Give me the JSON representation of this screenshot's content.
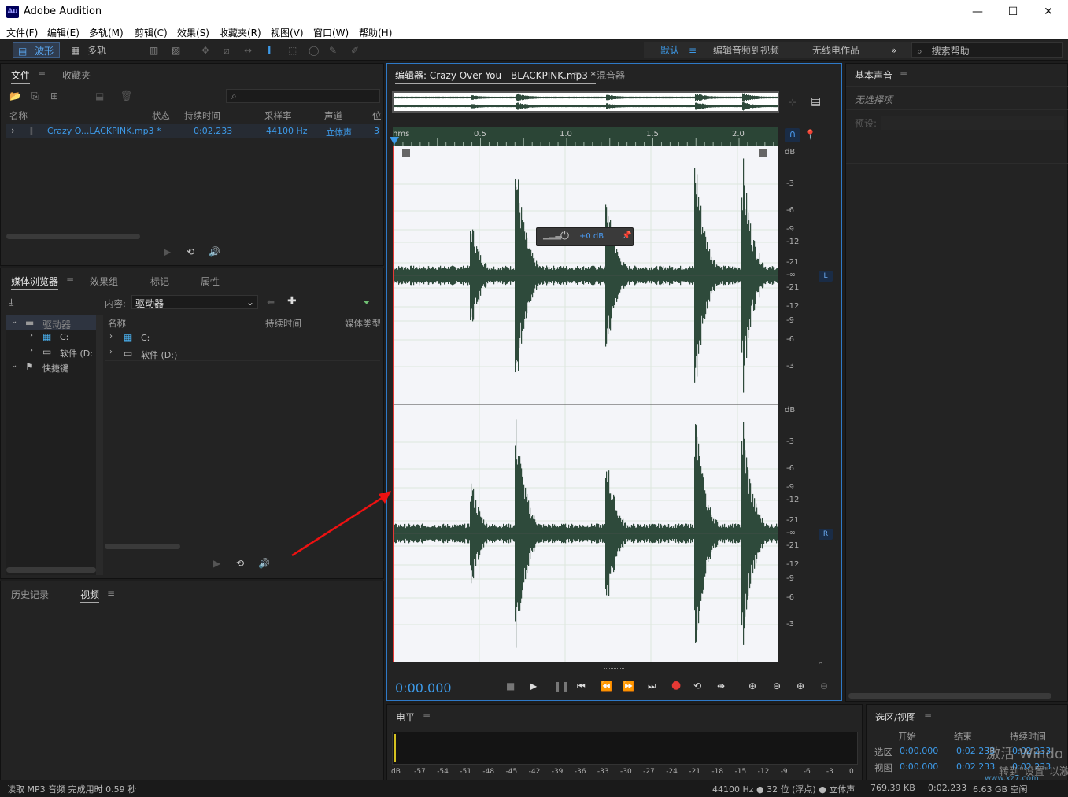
{
  "titlebar": {
    "app_title": "Adobe Audition",
    "logo": "Au",
    "minimize": "—",
    "maximize": "☐",
    "close": "✕"
  },
  "menu": [
    "文件(F)",
    "编辑(E)",
    "多轨(M)",
    "剪辑(C)",
    "效果(S)",
    "收藏夹(R)",
    "视图(V)",
    "窗口(W)",
    "帮助(H)"
  ],
  "toolbar": {
    "waveform_label": "波形",
    "multitrack_label": "多轨",
    "workspace_default": "默认",
    "workspace_edit_video": "编辑音频到视频",
    "workspace_radio": "无线电作品",
    "search_placeholder": "搜索帮助"
  },
  "files_panel": {
    "tabs": [
      "文件",
      "收藏夹"
    ],
    "columns": [
      "名称",
      "状态",
      "持续时间",
      "采样率",
      "声道",
      "位"
    ],
    "rows": [
      {
        "name": "Crazy O...LACKPINK.mp3 *",
        "duration": "0:02.233",
        "sample_rate": "44100 Hz",
        "channels": "立体声",
        "bit": "3"
      }
    ]
  },
  "media_panel": {
    "tabs": [
      "媒体浏览器",
      "效果组",
      "标记",
      "属性"
    ],
    "content_label": "内容:",
    "content_value": "驱动器",
    "tree": [
      "驱动器",
      "C:",
      "软件 (D:",
      "快捷键"
    ],
    "columns": [
      "名称",
      "持续时间",
      "媒体类型"
    ],
    "rows": [
      "C:",
      "软件 (D:)"
    ]
  },
  "history_panel": {
    "tabs": [
      "历史记录",
      "视频"
    ]
  },
  "editor": {
    "tab_label": "编辑器: Crazy Over You - BLACKPINK.mp3 *",
    "mixer_tab": "混音器",
    "ruler_labels": [
      "hms",
      "0.5",
      "1.0",
      "1.5",
      "2.0"
    ],
    "hud_gain": "+0 dB",
    "db_labels_top": [
      "dB",
      "-3",
      "-6",
      "-9",
      "-12",
      "-21",
      "-∞",
      "-21",
      "-12",
      "-9",
      "-6",
      "-3"
    ],
    "db_labels_bottom": [
      "dB",
      "-3",
      "-6",
      "-9",
      "-12",
      "-21",
      "-∞",
      "-21",
      "-12",
      "-9",
      "-6",
      "-3"
    ],
    "channel_left": "L",
    "channel_right": "R",
    "time_display": "0:00.000"
  },
  "essential_sound": {
    "title": "基本声音",
    "no_selection": "无选择项",
    "preset_label": "预设:"
  },
  "level_panel": {
    "title": "电平",
    "scale": [
      "dB",
      "-57",
      "-54",
      "-51",
      "-48",
      "-45",
      "-42",
      "-39",
      "-36",
      "-33",
      "-30",
      "-27",
      "-24",
      "-21",
      "-18",
      "-15",
      "-12",
      "-9",
      "-6",
      "-3",
      "0"
    ]
  },
  "selection_panel": {
    "title": "选区/视图",
    "col_start": "开始",
    "col_end": "结束",
    "col_duration": "持续时间",
    "sel_label": "选区",
    "view_label": "视图",
    "sel_start": "0:00.000",
    "sel_end": "0:02.233",
    "sel_duration": "0:02.233",
    "view_start": "0:00.000",
    "view_end": "0:02.233",
    "view_duration": "0:02.233"
  },
  "watermark": {
    "line1": "激活 Windo",
    "line2": "转到\"设置\"以激",
    "site": "www.xz7.com"
  },
  "statusbar": {
    "message": "读取 MP3 音频 完成用时 0.59 秒",
    "format": "44100 Hz ● 32 位 (浮点) ● 立体声",
    "size": "769.39 KB",
    "duration": "0:02.233",
    "free": "6.63 GB 空闲"
  },
  "colors": {
    "accent": "#3d9ae8",
    "waveform": "#2e4a3b",
    "record": "#e53935",
    "editor_border": "#2e79c7"
  }
}
